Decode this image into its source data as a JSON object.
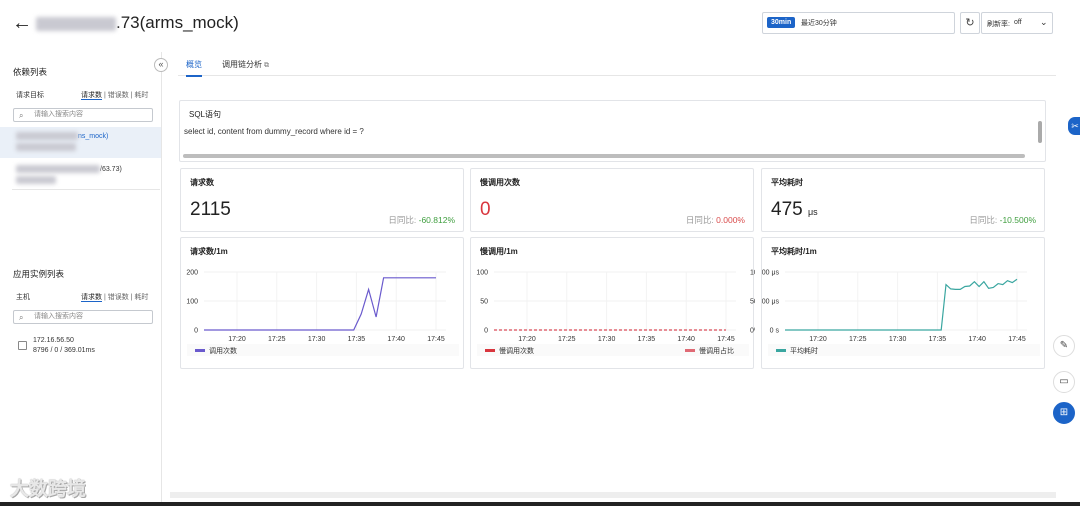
{
  "header": {
    "title_suffix": ".73(arms_mock)",
    "time_badge": "30min",
    "time_text": "最近30分钟",
    "refresh_label": "刷新率:",
    "refresh_value": "off"
  },
  "sidebar": {
    "dependency_title": "依赖列表",
    "request_target": "请求目标",
    "metric_tabs": [
      "请求数",
      "错误数",
      "耗时"
    ],
    "search_placeholder": "请输入搜索内容",
    "dep_items": [
      {
        "label": "ns_mock)"
      },
      {
        "label": "/63.73)"
      }
    ],
    "instance_title": "应用实例列表",
    "host_label": "主机",
    "instance_search_placeholder": "请输入搜索内容",
    "instance": {
      "ip": "172.16.56.50",
      "stats": "8796 / 0 / 369.01ms"
    }
  },
  "tabs": {
    "overview": "概览",
    "trace": "调用链分析"
  },
  "sql": {
    "title": "SQL语句",
    "text": "select id, content from dummy_record where id = ?"
  },
  "stats": [
    {
      "title": "请求数",
      "value": "2115",
      "unit": "",
      "cmp_label": "日同比:",
      "cmp_value": "-60.812%"
    },
    {
      "title": "慢调用次数",
      "value": "0",
      "unit": "",
      "cmp_label": "日同比:",
      "cmp_value": "0.000%"
    },
    {
      "title": "平均耗时",
      "value": "475",
      "unit": "μs",
      "cmp_label": "日同比:",
      "cmp_value": "-10.500%"
    }
  ],
  "colors": {
    "accent": "#1c64c8",
    "requests": "#6a5acd",
    "slow": "#d9363e",
    "latency": "#3aa6a0",
    "green": "#3f9e3f"
  },
  "chart_data": [
    {
      "type": "line",
      "title": "请求数/1m",
      "x": [
        "17:17",
        "17:18",
        "17:19",
        "17:20",
        "17:21",
        "17:22",
        "17:23",
        "17:24",
        "17:25",
        "17:26",
        "17:27",
        "17:28",
        "17:29",
        "17:30",
        "17:31",
        "17:32",
        "17:33",
        "17:34",
        "17:35",
        "17:36",
        "17:37",
        "17:38",
        "17:39",
        "17:40",
        "17:41",
        "17:42",
        "17:43",
        "17:44",
        "17:45",
        "17:46"
      ],
      "xticks": [
        "17:20",
        "17:25",
        "17:30",
        "17:35",
        "17:40",
        "17:45"
      ],
      "yticks": [
        "0",
        "100",
        "200"
      ],
      "ylim": [
        0,
        200
      ],
      "series": [
        {
          "name": "调用次数",
          "values": [
            0,
            0,
            0,
            0,
            0,
            0,
            0,
            0,
            0,
            0,
            0,
            0,
            0,
            0,
            0,
            0,
            0,
            0,
            0,
            0,
            0,
            55,
            140,
            45,
            180,
            180,
            180,
            180,
            180,
            180,
            180,
            180
          ]
        }
      ]
    },
    {
      "type": "line",
      "title": "慢调用/1m",
      "xticks": [
        "17:20",
        "17:25",
        "17:30",
        "17:35",
        "17:40",
        "17:45"
      ],
      "yticks": [
        "0",
        "50",
        "100"
      ],
      "yticks_right": [
        "0%",
        "50%",
        "100%"
      ],
      "ylim": [
        0,
        100
      ],
      "series": [
        {
          "name": "慢调用次数",
          "values": [
            0,
            0,
            0,
            0,
            0,
            0,
            0,
            0,
            0,
            0,
            0,
            0,
            0,
            0,
            0,
            0,
            0,
            0,
            0,
            0,
            0,
            0,
            0,
            0,
            0,
            0,
            0,
            0,
            0,
            0
          ]
        },
        {
          "name": "慢调用占比",
          "values": [
            0,
            0,
            0,
            0,
            0,
            0,
            0,
            0,
            0,
            0,
            0,
            0,
            0,
            0,
            0,
            0,
            0,
            0,
            0,
            0,
            0,
            0,
            0,
            0,
            0,
            0,
            0,
            0,
            0,
            0
          ]
        }
      ]
    },
    {
      "type": "line",
      "title": "平均耗时/1m",
      "xticks": [
        "17:20",
        "17:25",
        "17:30",
        "17:35",
        "17:40",
        "17:45"
      ],
      "yticks": [
        "0 s",
        "200 μs",
        "400 μs"
      ],
      "ylim": [
        0,
        600
      ],
      "series": [
        {
          "name": "平均耗时",
          "values": [
            0,
            0,
            0,
            0,
            0,
            0,
            0,
            0,
            0,
            0,
            0,
            0,
            0,
            0,
            0,
            0,
            0,
            0,
            0,
            0,
            0,
            0,
            0,
            0,
            0,
            0,
            0,
            0,
            0,
            0,
            0,
            0,
            0,
            0,
            470,
            425,
            420,
            420,
            450,
            455,
            500,
            450,
            500,
            430,
            440,
            480,
            470,
            510,
            490,
            525
          ]
        }
      ]
    }
  ],
  "watermark": "大数跨境"
}
